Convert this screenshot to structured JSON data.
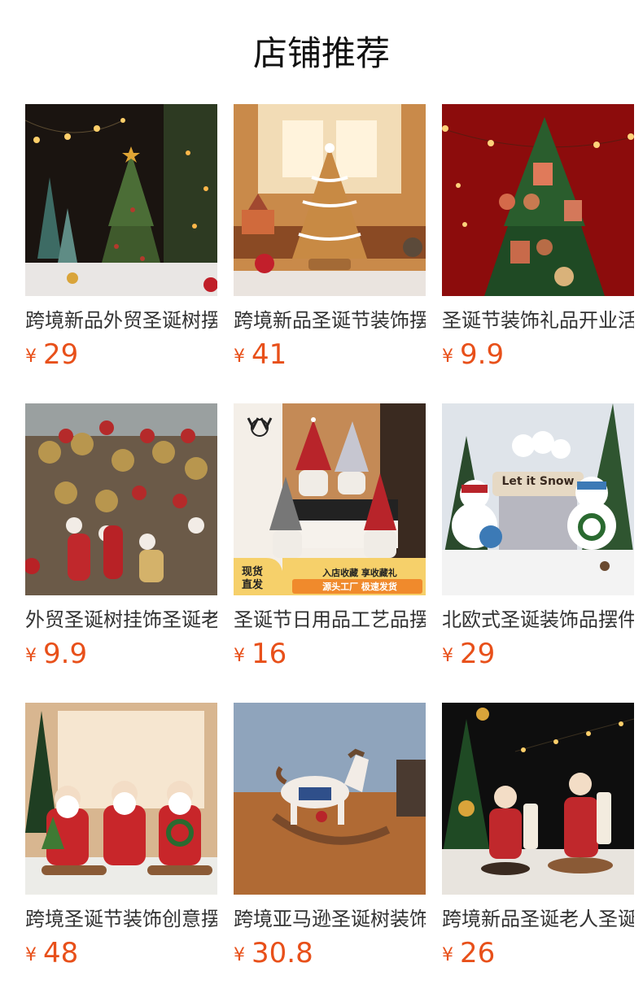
{
  "header": {
    "title": "店铺推荐"
  },
  "colors": {
    "price": "#e8501a",
    "text": "#333333"
  },
  "products": [
    {
      "name": "跨境新品外贸圣诞树摆件",
      "currency": "¥",
      "price": "29",
      "image": "ceramic-christmas-tree-image"
    },
    {
      "name": "跨境新品圣诞节装饰摆件",
      "currency": "¥",
      "price": "41",
      "image": "gingerbread-tree-image"
    },
    {
      "name": "圣诞节装饰礼品开业活动",
      "currency": "¥",
      "price": "9.9",
      "image": "decorated-tree-red-wall-image"
    },
    {
      "name": "外贸圣诞树挂饰圣诞老人",
      "currency": "¥",
      "price": "9.9",
      "image": "santa-figurines-pile-image"
    },
    {
      "name": "圣诞节日用品工艺品摆件",
      "currency": "¥",
      "price": "16",
      "image": "gnome-figurines-image",
      "badge_left": [
        "现货",
        "直发"
      ],
      "badge_right": [
        "入店收藏 享收藏礼",
        "源头工厂 极速发货"
      ]
    },
    {
      "name": "北欧式圣诞装饰品摆件",
      "currency": "¥",
      "price": "29",
      "image": "snowman-figurines-image",
      "sign": "Let it Snow"
    },
    {
      "name": "跨境圣诞节装饰创意摆件",
      "currency": "¥",
      "price": "48",
      "image": "three-santas-image"
    },
    {
      "name": "跨境亚马逊圣诞树装饰",
      "currency": "¥",
      "price": "30.8",
      "image": "rocking-horse-image"
    },
    {
      "name": "跨境新品圣诞老人圣诞",
      "currency": "¥",
      "price": "26",
      "image": "santa-scroll-image"
    }
  ]
}
